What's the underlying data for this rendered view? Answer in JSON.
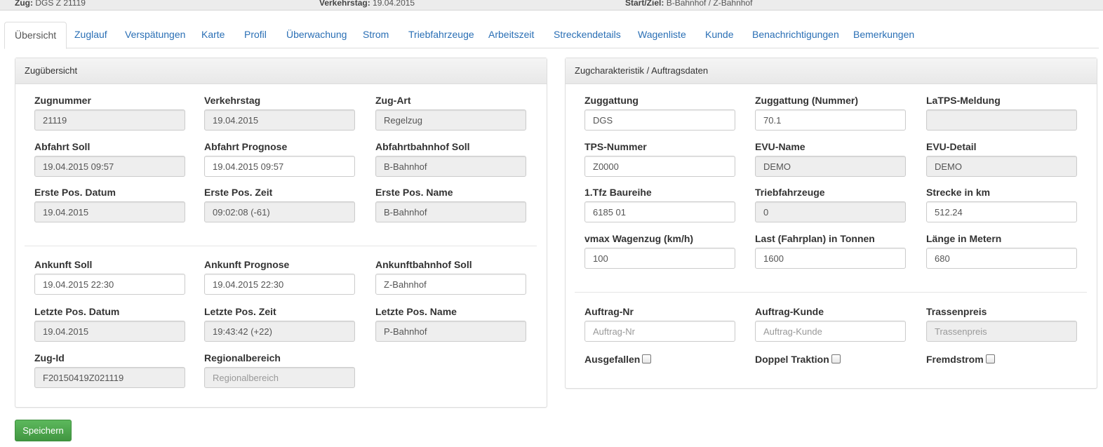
{
  "header": {
    "zug_label": "Zug:",
    "zug_value": "DGS Z 21119",
    "verkehrstag_label": "Verkehrstag:",
    "verkehrstag_value": "19.04.2015",
    "startziel_label": "Start/Ziel:",
    "startziel_value": "B-Bahnhof / Z-Bahnhof"
  },
  "tabs": [
    "Übersicht",
    "Zuglauf",
    "Verspätungen",
    "Karte",
    "Profil",
    "Überwachung",
    "Strom",
    "Triebfahrzeuge",
    "Arbeitszeit",
    "Streckendetails",
    "Wagenliste",
    "Kunde",
    "Benachrichtigungen",
    "Bemerkungen"
  ],
  "left_panel": {
    "title": "Zugübersicht",
    "fields": [
      {
        "label": "Zugnummer",
        "value": "21119",
        "readonly": true
      },
      {
        "label": "Verkehrstag",
        "value": "19.04.2015",
        "readonly": true
      },
      {
        "label": "Zug-Art",
        "value": "Regelzug",
        "readonly": true
      },
      {
        "label": "Abfahrt Soll",
        "value": "19.04.2015 09:57",
        "readonly": true
      },
      {
        "label": "Abfahrt Prognose",
        "value": "19.04.2015 09:57",
        "readonly": false
      },
      {
        "label": "Abfahrtbahnhof Soll",
        "value": "B-Bahnhof",
        "readonly": true
      },
      {
        "label": "Erste Pos. Datum",
        "value": "19.04.2015",
        "readonly": true
      },
      {
        "label": "Erste Pos. Zeit",
        "value": "09:02:08 (-61)",
        "readonly": true
      },
      {
        "label": "Erste Pos. Name",
        "value": "B-Bahnhof",
        "readonly": true
      },
      {
        "label": "Ankunft Soll",
        "value": "19.04.2015 22:30",
        "readonly": false
      },
      {
        "label": "Ankunft Prognose",
        "value": "19.04.2015 22:30",
        "readonly": false
      },
      {
        "label": "Ankunftbahnhof Soll",
        "value": "Z-Bahnhof",
        "readonly": false
      },
      {
        "label": "Letzte Pos. Datum",
        "value": "19.04.2015",
        "readonly": true
      },
      {
        "label": "Letzte Pos. Zeit",
        "value": "19:43:42 (+22)",
        "readonly": true
      },
      {
        "label": "Letzte Pos. Name",
        "value": "P-Bahnhof",
        "readonly": true
      },
      {
        "label": "Zug-Id",
        "value": "F20150419Z021119",
        "readonly": true
      },
      {
        "label": "Regionalbereich",
        "value": "",
        "placeholder": "Regionalbereich",
        "readonly": true
      }
    ]
  },
  "right_panel": {
    "title": "Zugcharakteristik / Auftragsdaten",
    "fields": [
      {
        "label": "Zuggattung",
        "value": "DGS",
        "readonly": false
      },
      {
        "label": "Zuggattung (Nummer)",
        "value": "70.1",
        "readonly": false
      },
      {
        "label": "LaTPS-Meldung",
        "value": "",
        "readonly": true
      },
      {
        "label": "TPS-Nummer",
        "value": "Z0000",
        "readonly": false
      },
      {
        "label": "EVU-Name",
        "value": "DEMO",
        "readonly": true
      },
      {
        "label": "EVU-Detail",
        "value": "DEMO",
        "readonly": true
      },
      {
        "label": "1.Tfz Baureihe",
        "value": "6185 01",
        "readonly": false
      },
      {
        "label": "Triebfahrzeuge",
        "value": "0",
        "readonly": true
      },
      {
        "label": "Strecke in km",
        "value": "512.24",
        "readonly": false
      },
      {
        "label": "vmax Wagenzug (km/h)",
        "value": "100",
        "readonly": false
      },
      {
        "label": "Last (Fahrplan) in Tonnen",
        "value": "1600",
        "readonly": false
      },
      {
        "label": "Länge in Metern",
        "value": "680",
        "readonly": false
      },
      {
        "label": "Auftrag-Nr",
        "value": "",
        "placeholder": "Auftrag-Nr",
        "readonly": false
      },
      {
        "label": "Auftrag-Kunde",
        "value": "",
        "placeholder": "Auftrag-Kunde",
        "readonly": false
      },
      {
        "label": "Trassenpreis",
        "value": "",
        "placeholder": "Trassenpreis",
        "readonly": true
      }
    ],
    "checkboxes": [
      {
        "label": "Ausgefallen",
        "checked": false
      },
      {
        "label": "Doppel Traktion",
        "checked": false
      },
      {
        "label": "Fremdstrom",
        "checked": false
      }
    ]
  },
  "save_button": "Speichern"
}
